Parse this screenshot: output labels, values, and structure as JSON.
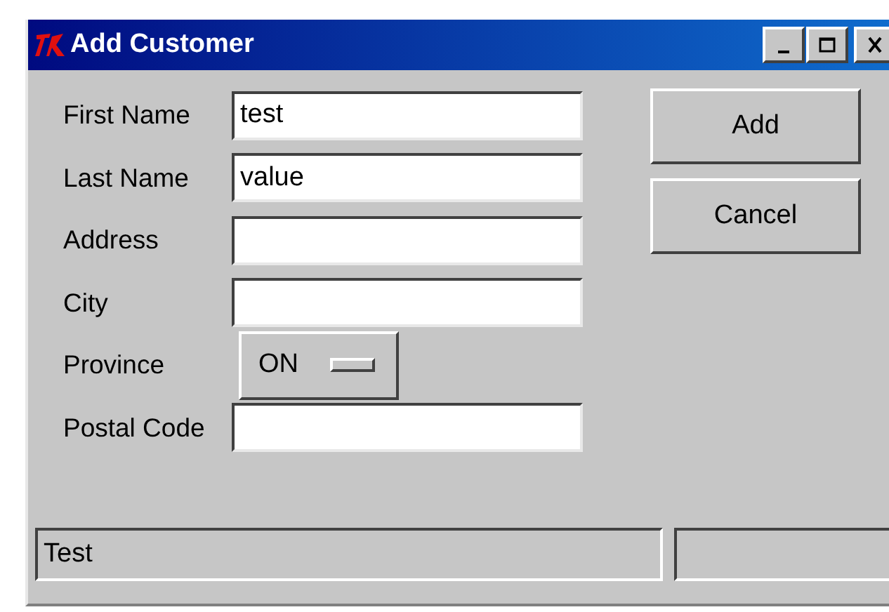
{
  "window": {
    "title": "Add Customer"
  },
  "fields": [
    {
      "label": "First Name",
      "kind": "entry",
      "value": "test"
    },
    {
      "label": "Last Name",
      "kind": "entry",
      "value": "value"
    },
    {
      "label": "Address",
      "kind": "entry"
    },
    {
      "label": "City",
      "kind": "entry"
    },
    {
      "label": "Province",
      "kind": "option",
      "value": "ON"
    },
    {
      "label": "Postal Code",
      "kind": "entry"
    }
  ],
  "buttons": [
    "Add",
    "Cancel"
  ],
  "status_bar": {
    "text": "Test"
  }
}
